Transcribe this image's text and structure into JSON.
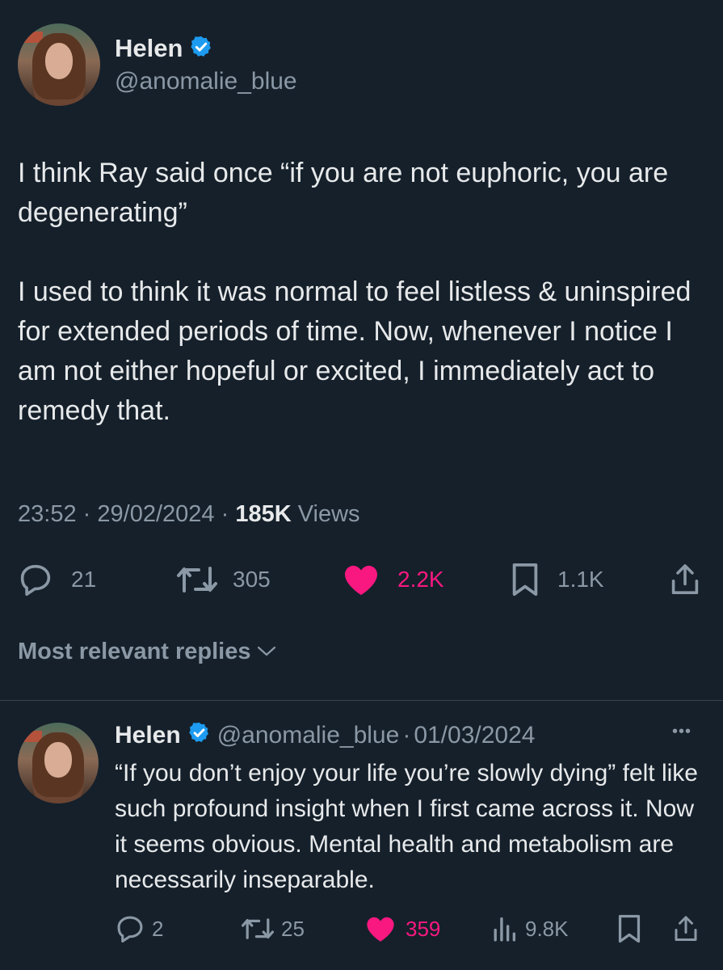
{
  "tweet": {
    "author_name": "Helen",
    "author_handle": "@anomalie_blue",
    "text": "I think Ray said once “if you are not euphoric, you are degenerating”\n\nI used to think it was normal to feel listless & uninspired for extended periods of time. Now, whenever I notice I am not either hopeful or excited, I immediately act to remedy that.",
    "time": "23:52",
    "date": "29/02/2024",
    "views_count": "185K",
    "views_label": "Views",
    "separator": "·",
    "replies": "21",
    "retweets": "305",
    "likes": "2.2K",
    "bookmarks": "1.1K"
  },
  "replies_header": {
    "label": "Most relevant replies"
  },
  "reply": {
    "author_name": "Helen",
    "author_handle": "@anomalie_blue",
    "date": "01/03/2024",
    "separator": "·",
    "more": "•••",
    "text": "“If you don’t enjoy your life you’re slowly dying” felt like such profound insight when I first came across it. Now it seems obvious. Mental health and metabolism are necessarily inseparable.",
    "replies": "2",
    "retweets": "25",
    "likes": "359",
    "views": "9.8K"
  },
  "colors": {
    "background": "#15202b",
    "text": "#e7e9ea",
    "secondary": "#8b98a5",
    "like": "#f91880",
    "verified": "#1d9bf0"
  },
  "icons": [
    "verified-badge-icon",
    "reply-icon",
    "retweet-icon",
    "heart-icon",
    "bookmark-icon",
    "share-icon",
    "analytics-icon",
    "more-icon",
    "chevron-down-icon"
  ]
}
